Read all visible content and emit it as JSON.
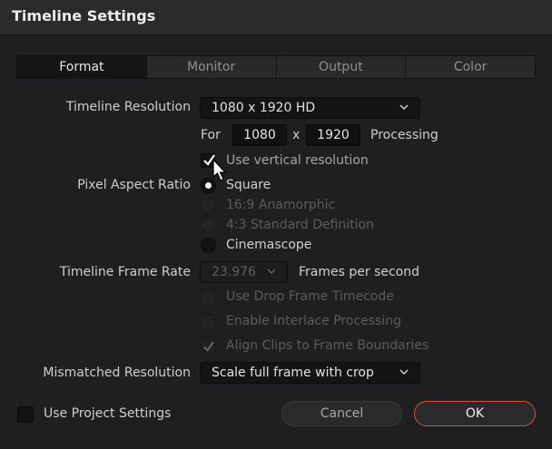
{
  "window": {
    "title": "Timeline Settings"
  },
  "tabs": [
    {
      "label": "Format",
      "active": true
    },
    {
      "label": "Monitor",
      "active": false
    },
    {
      "label": "Output",
      "active": false
    },
    {
      "label": "Color",
      "active": false
    }
  ],
  "resolution": {
    "label": "Timeline Resolution",
    "selected": "1080 x 1920 HD",
    "for_label": "For",
    "width": "1080",
    "x_label": "x",
    "height": "1920",
    "processing_label": "Processing",
    "vertical_label": "Use vertical resolution",
    "vertical_checked": true
  },
  "pixel_aspect": {
    "label": "Pixel Aspect Ratio",
    "options": [
      {
        "label": "Square",
        "checked": true,
        "enabled": true
      },
      {
        "label": "16:9 Anamorphic",
        "checked": false,
        "enabled": false
      },
      {
        "label": "4:3 Standard Definition",
        "checked": false,
        "enabled": false
      },
      {
        "label": "Cinemascope",
        "checked": false,
        "enabled": true
      }
    ]
  },
  "frame_rate": {
    "label": "Timeline Frame Rate",
    "selected": "23.976",
    "unit_label": "Frames per second",
    "options": [
      {
        "label": "Use Drop Frame Timecode",
        "checked": false
      },
      {
        "label": "Enable Interlace Processing",
        "checked": false
      },
      {
        "label": "Align Clips to Frame Boundaries",
        "checked": true
      }
    ]
  },
  "mismatched": {
    "label": "Mismatched Resolution",
    "selected": "Scale full frame with crop"
  },
  "footer": {
    "project_settings_label": "Use Project Settings",
    "project_settings_checked": false,
    "cancel_label": "Cancel",
    "ok_label": "OK"
  },
  "colors": {
    "ok_border": "#d6533f",
    "background": "#1f1f21"
  }
}
